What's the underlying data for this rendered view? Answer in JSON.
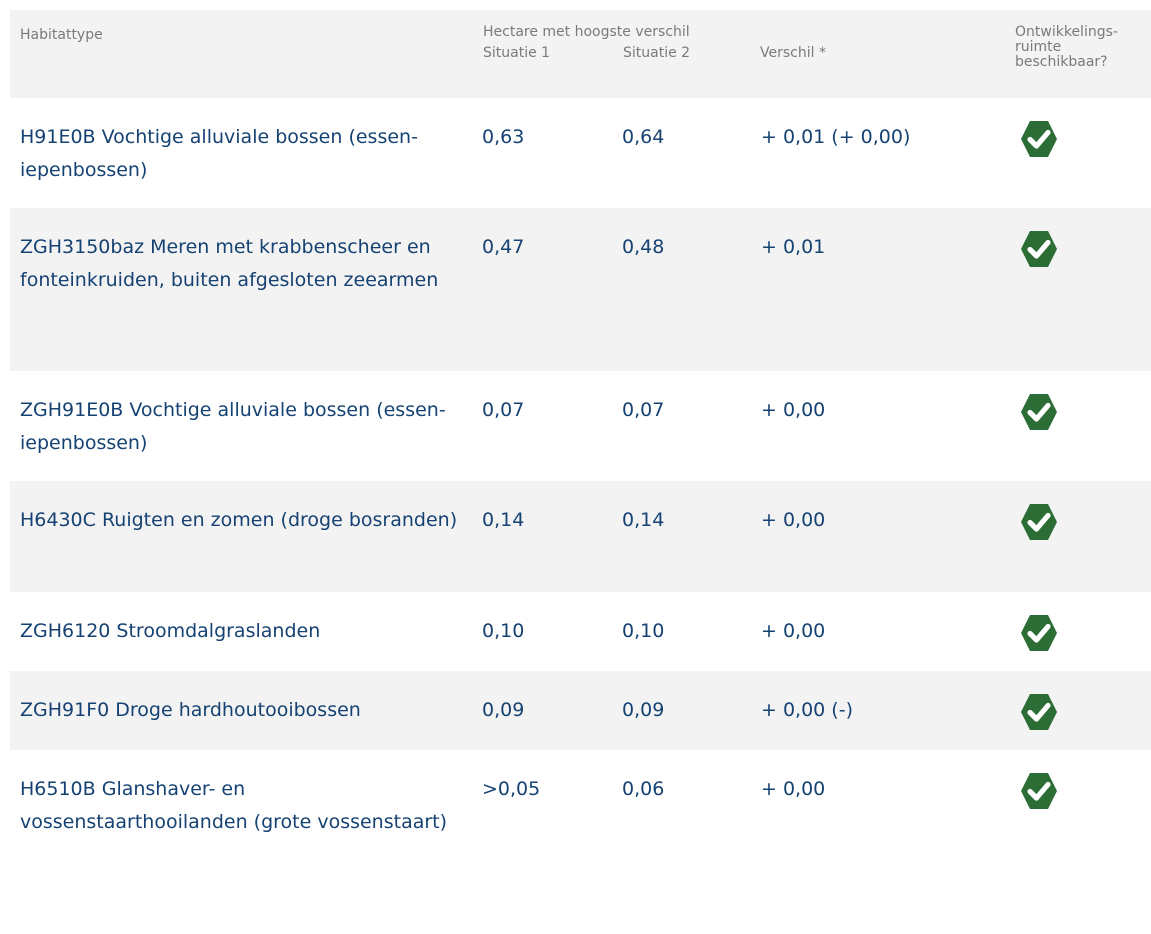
{
  "header": {
    "habitattype": "Habitattype",
    "hectare": "Hectare met hoogste verschil",
    "situatie1": "Situatie 1",
    "situatie2": "Situatie 2",
    "verschil": "Verschil *",
    "ontwikkelingsruimte_line1": "Ontwikkelings-",
    "ontwikkelingsruimte_line2": "ruimte",
    "ontwikkelingsruimte_line3": "beschikbaar?"
  },
  "rows": [
    {
      "name": "H91E0B Vochtige alluviale bossen (essen-iepenbossen)",
      "situatie1": "0,63",
      "situatie2": "0,64",
      "verschil": "+ 0,01 (+ 0,00)",
      "beschikbaar": "check-icon"
    },
    {
      "name": "ZGH3150baz Meren met krabbenscheer en fonteinkruiden, buiten afgesloten zeearmen",
      "situatie1": "0,47",
      "situatie2": "0,48",
      "verschil": "+ 0,01",
      "beschikbaar": "check-icon"
    },
    {
      "name": "ZGH91E0B Vochtige alluviale bossen (essen-iepenbossen)",
      "situatie1": "0,07",
      "situatie2": "0,07",
      "verschil": "+ 0,00",
      "beschikbaar": "check-icon"
    },
    {
      "name": "H6430C Ruigten en zomen (droge bosranden)",
      "situatie1": "0,14",
      "situatie2": "0,14",
      "verschil": "+ 0,00",
      "beschikbaar": "check-icon"
    },
    {
      "name": "ZGH6120 Stroomdalgraslanden",
      "situatie1": "0,10",
      "situatie2": "0,10",
      "verschil": "+ 0,00",
      "beschikbaar": "check-icon"
    },
    {
      "name": "ZGH91F0 Droge hardhoutooibossen",
      "situatie1": "0,09",
      "situatie2": "0,09",
      "verschil": "+ 0,00 (-)",
      "beschikbaar": "check-icon"
    },
    {
      "name": "H6510B Glanshaver- en vossenstaarthooilanden (grote vossenstaart)",
      "situatie1": ">0,05",
      "situatie2": "0,06",
      "verschil": "+ 0,00",
      "beschikbaar": "check-icon"
    }
  ],
  "colors": {
    "text": "#154273",
    "header_text": "#7a7a7a",
    "stripe": "#f3f3f3",
    "check": "#2b6d35"
  }
}
